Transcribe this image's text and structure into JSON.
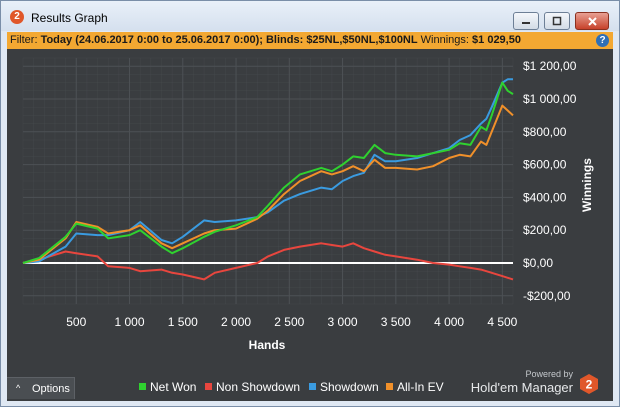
{
  "window": {
    "title": "Results Graph",
    "app_icon_text": "2",
    "minimize_icon": "minimize-icon",
    "maximize_icon": "maximize-icon",
    "close_icon": "close-icon"
  },
  "filter": {
    "prefix": "Filter:",
    "text": "Today (24.06.2017 0:00 to 25.06.2017 0:00); Blinds: $25NL,$50NL,$100NL",
    "winnings_label": "Winnings:",
    "winnings_value": "$1 029,50",
    "help_icon": "?"
  },
  "options": {
    "label": "Options",
    "caret": "^"
  },
  "branding": {
    "powered_by": "Powered by",
    "name": "Hold'em Manager",
    "logo_text": "2"
  },
  "colors": {
    "background": "#3a3d40",
    "grid": "#4d5155",
    "net_won": "#2fd12f",
    "non_showdown": "#e8463e",
    "showdown": "#3a9be0",
    "all_in_ev": "#f0902a",
    "filter_bar": "#f3a832"
  },
  "chart_data": {
    "type": "line",
    "title": "",
    "xlabel": "Hands",
    "ylabel": "Winnings",
    "xlim": [
      0,
      4600
    ],
    "ylim": [
      -250,
      1250
    ],
    "grid": true,
    "legend_position": "bottom-center",
    "x_ticks": [
      500,
      1000,
      1500,
      2000,
      2500,
      3000,
      3500,
      4000,
      4500
    ],
    "x_tick_labels": [
      "500",
      "1 000",
      "1 500",
      "2 000",
      "2 500",
      "3 000",
      "3 500",
      "4 000",
      "4 500"
    ],
    "y_ticks": [
      1200,
      1000,
      800,
      600,
      400,
      200,
      0,
      -200
    ],
    "y_tick_labels": [
      "$1 200,00",
      "$1 000,00",
      "$800,00",
      "$600,00",
      "$400,00",
      "$200,00",
      "$0,00",
      "-$200,00"
    ],
    "x": [
      0,
      150,
      400,
      500,
      700,
      800,
      1000,
      1100,
      1300,
      1400,
      1500,
      1700,
      1800,
      2000,
      2200,
      2300,
      2450,
      2600,
      2800,
      2900,
      3000,
      3100,
      3200,
      3300,
      3400,
      3500,
      3700,
      3850,
      4000,
      4100,
      4200,
      4300,
      4350,
      4400,
      4500,
      4550,
      4600
    ],
    "series": [
      {
        "name": "Net Won",
        "color_key": "net_won",
        "values": [
          0,
          30,
          160,
          240,
          210,
          150,
          170,
          200,
          100,
          60,
          90,
          160,
          190,
          230,
          280,
          350,
          460,
          540,
          580,
          560,
          600,
          650,
          640,
          720,
          670,
          660,
          650,
          670,
          690,
          730,
          720,
          830,
          810,
          900,
          1100,
          1050,
          1030
        ]
      },
      {
        "name": "Non Showdown",
        "color_key": "non_showdown",
        "values": [
          0,
          20,
          70,
          60,
          40,
          -20,
          -30,
          -50,
          -40,
          -60,
          -70,
          -100,
          -60,
          -30,
          0,
          40,
          80,
          100,
          120,
          110,
          100,
          120,
          90,
          70,
          50,
          40,
          20,
          0,
          -10,
          -20,
          -30,
          -40,
          -50,
          -60,
          -80,
          -90,
          -100
        ]
      },
      {
        "name": "Showdown",
        "color_key": "showdown",
        "values": [
          0,
          10,
          100,
          180,
          170,
          170,
          200,
          250,
          140,
          120,
          160,
          260,
          250,
          260,
          280,
          310,
          380,
          420,
          460,
          450,
          500,
          530,
          550,
          660,
          620,
          620,
          640,
          670,
          700,
          750,
          780,
          850,
          880,
          950,
          1100,
          1120,
          1120
        ]
      },
      {
        "name": "All-In EV",
        "color_key": "all_in_ev",
        "values": [
          0,
          20,
          150,
          250,
          220,
          180,
          200,
          230,
          120,
          90,
          120,
          180,
          200,
          210,
          270,
          320,
          420,
          500,
          560,
          540,
          560,
          590,
          560,
          630,
          580,
          580,
          570,
          590,
          640,
          660,
          650,
          740,
          720,
          800,
          960,
          930,
          900
        ]
      }
    ]
  }
}
